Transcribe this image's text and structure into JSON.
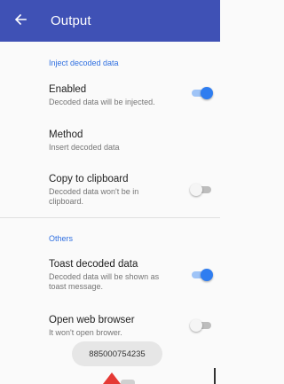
{
  "appbar": {
    "title": "Output",
    "back_icon": "arrow-back-icon",
    "bg": "#3f51b5"
  },
  "sections": {
    "inject": {
      "header": "Inject decoded data",
      "enabled": {
        "title": "Enabled",
        "summary": "Decoded data will be injected.",
        "on": true
      },
      "method": {
        "title": "Method",
        "summary": "Insert decoded data"
      },
      "clipboard": {
        "title": "Copy to clipboard",
        "summary": "Decoded data won't be in clipboard.",
        "on": false
      }
    },
    "others": {
      "header": "Others",
      "toast": {
        "title": "Toast decoded data",
        "summary": "Decoded data will be shown as toast message.",
        "on": true
      },
      "browser": {
        "title": "Open web browser",
        "summary": "It won't open brower.",
        "on": false
      }
    }
  },
  "toast_message": "885000754235",
  "colors": {
    "accent": "#2f7df0",
    "header": "#2f6fe0",
    "pointer": "#e53935"
  }
}
